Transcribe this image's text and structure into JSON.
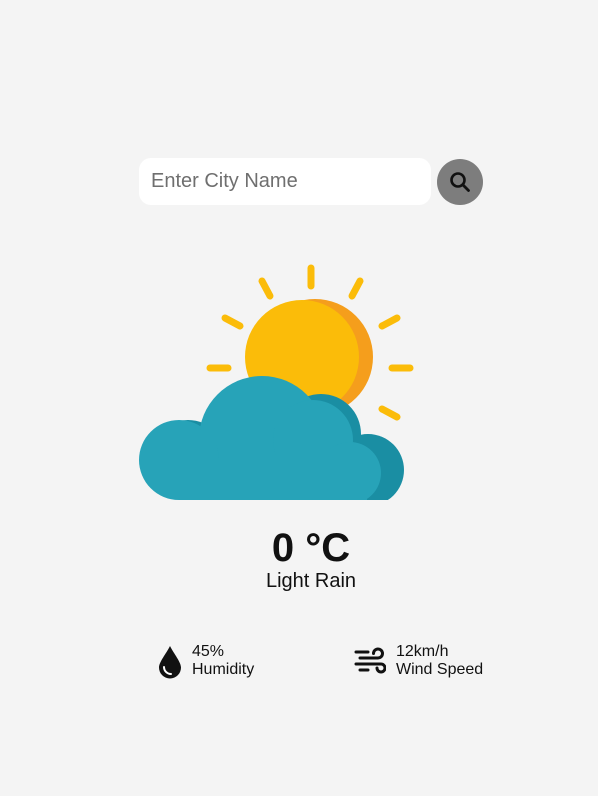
{
  "search": {
    "placeholder": "Enter City Name",
    "button_icon": "search-icon"
  },
  "weather": {
    "icon": "sun-behind-cloud-icon",
    "temperature": "0 °C",
    "condition": "Light Rain"
  },
  "stats": {
    "humidity": {
      "icon": "water-drop-icon",
      "value": "45%",
      "label": "Humidity"
    },
    "wind": {
      "icon": "wind-icon",
      "value": "12km/h",
      "label": "Wind Speed"
    }
  },
  "colors": {
    "background": "#f4f4f4",
    "search_button": "#7d7d7d",
    "sun": "#fbbc09",
    "sun_shadow": "#f59e1c",
    "cloud": "#27a3b8",
    "cloud_shadow": "#1a8ea3"
  }
}
